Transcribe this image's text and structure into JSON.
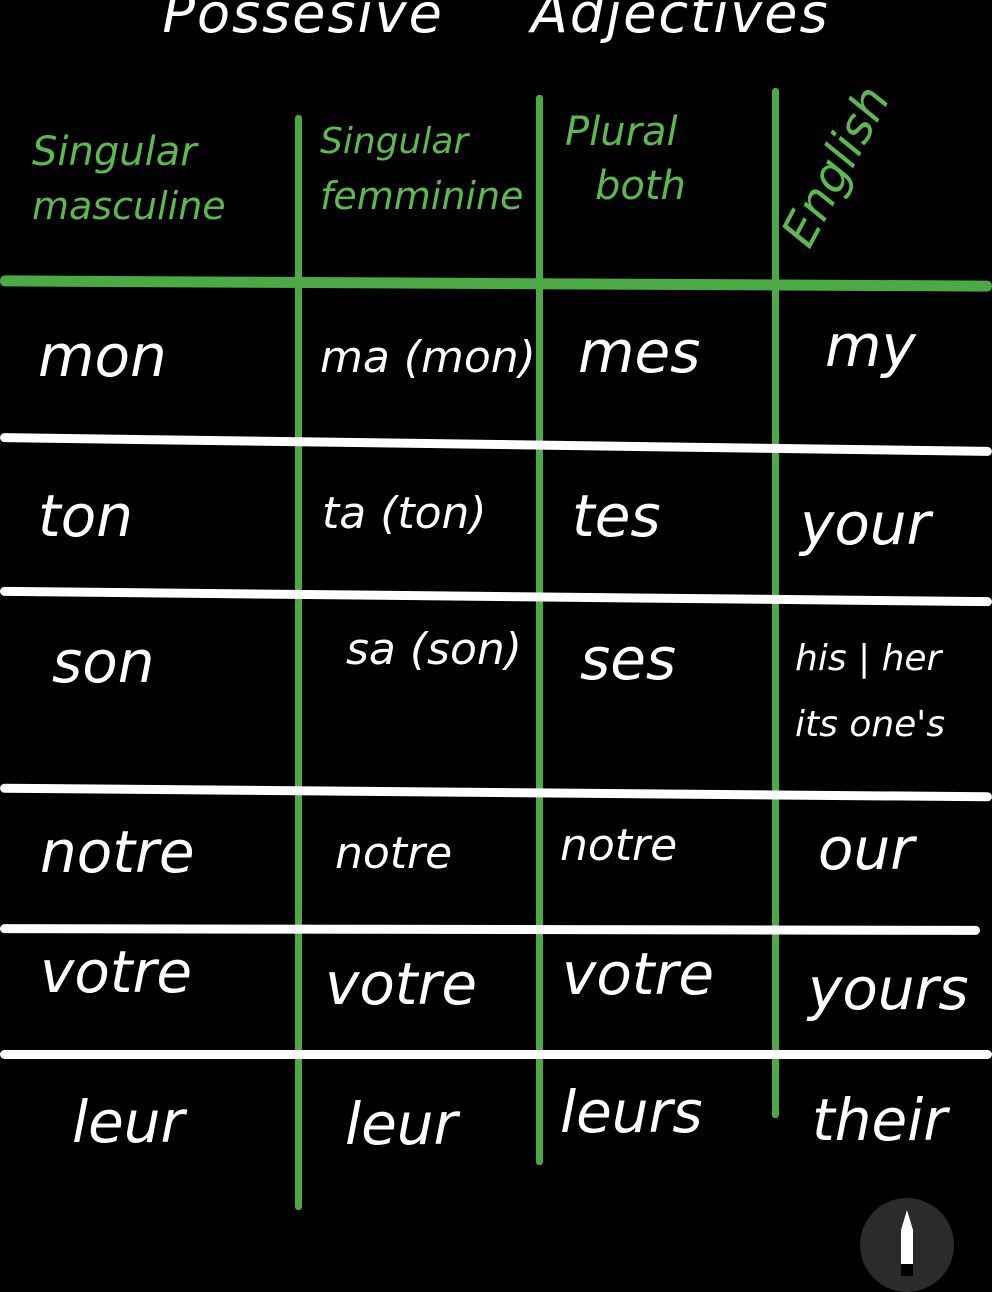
{
  "title": {
    "word1": "Possesive",
    "word2": "Adjectives"
  },
  "headers": {
    "col1": {
      "line1": "Singular",
      "line2": "masculine"
    },
    "col2": {
      "line1": "Singular",
      "line2": "femminine"
    },
    "col3": {
      "line1": "Plural",
      "line2": "both"
    },
    "col4": "English"
  },
  "rows": [
    {
      "sm": "mon",
      "sf": "ma (mon)",
      "pl": "mes",
      "en": "my"
    },
    {
      "sm": "ton",
      "sf": "ta (ton)",
      "pl": "tes",
      "en": "your"
    },
    {
      "sm": "son",
      "sf": "sa (son)",
      "pl": "ses",
      "en_line1": "his | her",
      "en_line2": "its one's"
    },
    {
      "sm": "notre",
      "sf": "notre",
      "pl": "notre",
      "en": "our"
    },
    {
      "sm": "votre",
      "sf": "votre",
      "pl": "votre",
      "en": "yours"
    },
    {
      "sm": "leur",
      "sf": "leur",
      "pl": "leurs",
      "en": "their"
    }
  ],
  "tools": {
    "pen_icon": "pen-icon"
  },
  "colors": {
    "background": "#000000",
    "header_green": "#5cb84f",
    "grid_green": "#4caa44",
    "ink_white": "#ffffff"
  }
}
